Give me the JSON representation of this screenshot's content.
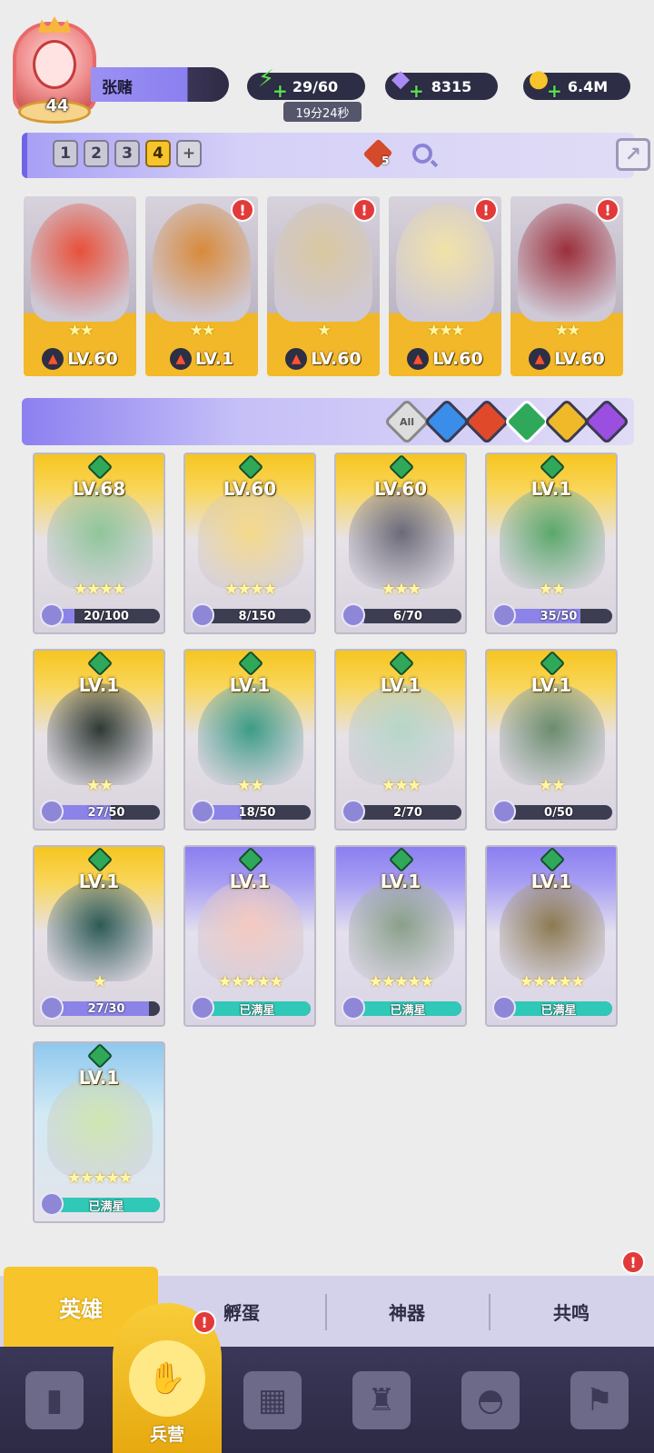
{
  "player": {
    "level": "44",
    "name": "张赌"
  },
  "resources": {
    "energy": {
      "value": "29/60",
      "timer": "19分24秒",
      "icon": "lightning-icon"
    },
    "gems": {
      "value": "8315",
      "icon": "gem-icon"
    },
    "coins": {
      "value": "6.4M",
      "icon": "coin-icon"
    }
  },
  "team": {
    "tabs": [
      "1",
      "2",
      "3",
      "4",
      "+"
    ],
    "active_tab": "4",
    "power_badge": "5",
    "heroes": [
      {
        "stars": "★★",
        "level": "LV.60",
        "alert": "",
        "art_color": "#e8503a"
      },
      {
        "stars": "★★",
        "level": "LV.1",
        "alert": "!",
        "art_color": "#d88a3a"
      },
      {
        "stars": "★",
        "level": "LV.60",
        "alert": "!",
        "art_color": "#d9c8a0"
      },
      {
        "stars": "★★★",
        "level": "LV.60",
        "alert": "!",
        "art_color": "#f2e3a8"
      },
      {
        "stars": "★★",
        "level": "LV.60",
        "alert": "!",
        "art_color": "#9b2f3a"
      }
    ]
  },
  "filters": [
    {
      "label": "All",
      "icon": "all-icon",
      "color": "#dddddd"
    },
    {
      "label": "",
      "icon": "water-icon",
      "color": "#3a8de8"
    },
    {
      "label": "",
      "icon": "fire-icon",
      "color": "#e04a2a"
    },
    {
      "label": "",
      "icon": "nature-icon",
      "color": "#2fa85a"
    },
    {
      "label": "",
      "icon": "light-icon",
      "color": "#f0b92a"
    },
    {
      "label": "",
      "icon": "dark-icon",
      "color": "#9b4fe0"
    }
  ],
  "heroes": [
    {
      "level": "LV.68",
      "stars": "★★★★",
      "progress": "20/100",
      "fraction": 0.2,
      "tier": "gold",
      "art": "#8fc59a"
    },
    {
      "level": "LV.60",
      "stars": "★★★★",
      "progress": "8/150",
      "fraction": 0.053,
      "tier": "gold",
      "art": "#f4d88a"
    },
    {
      "level": "LV.60",
      "stars": "★★★",
      "progress": "6/70",
      "fraction": 0.086,
      "tier": "gold",
      "art": "#6b6a78"
    },
    {
      "level": "LV.1",
      "stars": "★★",
      "progress": "35/50",
      "fraction": 0.7,
      "tier": "gold",
      "art": "#5aa86a"
    },
    {
      "level": "LV.1",
      "stars": "★★",
      "progress": "27/50",
      "fraction": 0.54,
      "tier": "gold",
      "art": "#2f3a34"
    },
    {
      "level": "LV.1",
      "stars": "★★",
      "progress": "18/50",
      "fraction": 0.36,
      "tier": "gold",
      "art": "#3c9c86"
    },
    {
      "level": "LV.1",
      "stars": "★★★",
      "progress": "2/70",
      "fraction": 0.029,
      "tier": "gold",
      "art": "#b6d6c8"
    },
    {
      "level": "LV.1",
      "stars": "★★",
      "progress": "0/50",
      "fraction": 0.0,
      "tier": "gold",
      "art": "#6b8c6e"
    },
    {
      "level": "LV.1",
      "stars": "★",
      "progress": "27/30",
      "fraction": 0.9,
      "tier": "gold",
      "art": "#2d5a55"
    },
    {
      "level": "LV.1",
      "stars": "★★★★★",
      "progress": "已满星",
      "fraction": 1.0,
      "tier": "purple",
      "art": "#f4c9c0"
    },
    {
      "level": "LV.1",
      "stars": "★★★★★",
      "progress": "已满星",
      "fraction": 1.0,
      "tier": "purple",
      "art": "#8aa08a"
    },
    {
      "level": "LV.1",
      "stars": "★★★★★",
      "progress": "已满星",
      "fraction": 1.0,
      "tier": "purple",
      "art": "#8c7a52"
    },
    {
      "level": "LV.1",
      "stars": "★★★★★",
      "progress": "已满星",
      "fraction": 1.0,
      "tier": "gold-blue",
      "art": "#cfe6b2"
    }
  ],
  "sub_tabs": [
    {
      "label": "英雄",
      "active": true
    },
    {
      "label": "孵蛋",
      "active": false
    },
    {
      "label": "神器",
      "active": false
    },
    {
      "label": "共鸣",
      "active": false
    }
  ],
  "nav": [
    {
      "label": "",
      "icon": "cards-icon"
    },
    {
      "label": "兵营",
      "icon": "barracks-icon",
      "active": true,
      "alert": "!"
    },
    {
      "label": "",
      "icon": "map-icon"
    },
    {
      "label": "",
      "icon": "castle-icon"
    },
    {
      "label": "",
      "icon": "mushroom-icon"
    },
    {
      "label": "",
      "icon": "banner-icon"
    }
  ],
  "colors": {
    "accent_gold": "#f7c52b",
    "accent_purple": "#8b7ff0",
    "alert_red": "#e23a3a"
  }
}
